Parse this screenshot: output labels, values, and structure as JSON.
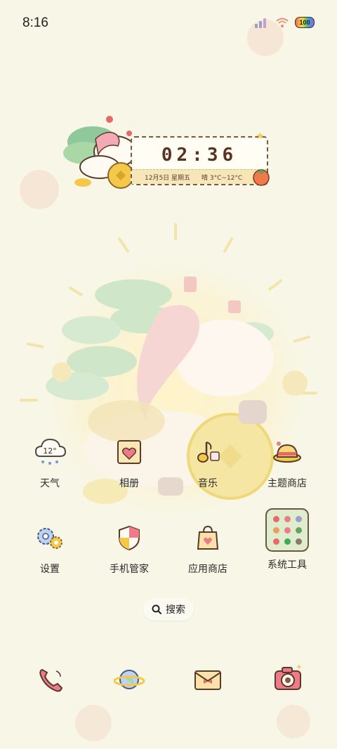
{
  "status": {
    "time": "8:16",
    "battery": "100"
  },
  "widget": {
    "time": "02:36",
    "date": "12月5日 星期五",
    "weather": "晴 3°C~12°C"
  },
  "apps": {
    "weather": {
      "label": "天气",
      "icon_text": "12°"
    },
    "gallery": {
      "label": "相册"
    },
    "music": {
      "label": "音乐"
    },
    "themes": {
      "label": "主题商店"
    },
    "settings": {
      "label": "设置"
    },
    "security": {
      "label": "手机管家"
    },
    "appstore": {
      "label": "应用商店"
    },
    "tools": {
      "label": "系统工具"
    }
  },
  "search": {
    "label": "搜索"
  },
  "dock": [
    "phone-icon",
    "browser-icon",
    "messages-icon",
    "camera-icon"
  ],
  "colors": {
    "background": "#f8f6e6",
    "accent_brown": "#5a3320",
    "folder_bg": "#dfeccd"
  }
}
